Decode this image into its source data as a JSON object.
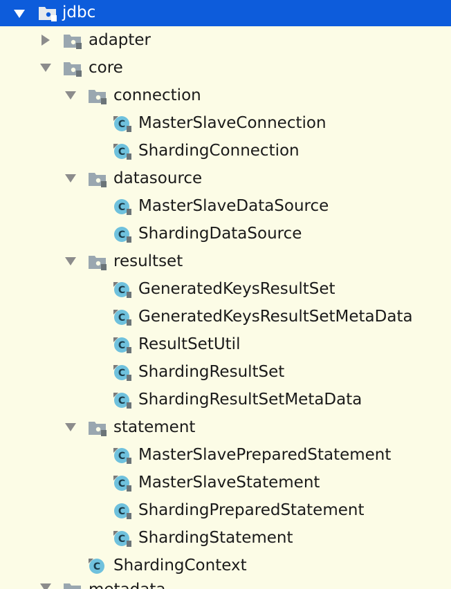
{
  "tree": {
    "root": {
      "label": "jdbc",
      "expanded": true,
      "selected": true
    },
    "rows": [
      {
        "level": 1,
        "kind": "package",
        "expanded": false,
        "label": "adapter"
      },
      {
        "level": 1,
        "kind": "package",
        "expanded": true,
        "label": "core"
      },
      {
        "level": 2,
        "kind": "package",
        "expanded": true,
        "label": "connection"
      },
      {
        "level": 3,
        "kind": "class",
        "label": "MasterSlaveConnection"
      },
      {
        "level": 3,
        "kind": "class",
        "label": "ShardingConnection"
      },
      {
        "level": 2,
        "kind": "package",
        "expanded": true,
        "label": "datasource"
      },
      {
        "level": 3,
        "kind": "class",
        "label": "MasterSlaveDataSource"
      },
      {
        "level": 3,
        "kind": "class",
        "label": "ShardingDataSource"
      },
      {
        "level": 2,
        "kind": "package",
        "expanded": true,
        "label": "resultset"
      },
      {
        "level": 3,
        "kind": "class",
        "label": "GeneratedKeysResultSet"
      },
      {
        "level": 3,
        "kind": "class",
        "label": "GeneratedKeysResultSetMetaData"
      },
      {
        "level": 3,
        "kind": "class",
        "label": "ResultSetUtil"
      },
      {
        "level": 3,
        "kind": "class",
        "label": "ShardingResultSet"
      },
      {
        "level": 3,
        "kind": "class",
        "label": "ShardingResultSetMetaData"
      },
      {
        "level": 2,
        "kind": "package",
        "expanded": true,
        "label": "statement"
      },
      {
        "level": 3,
        "kind": "class",
        "label": "MasterSlavePreparedStatement"
      },
      {
        "level": 3,
        "kind": "class",
        "label": "MasterSlaveStatement"
      },
      {
        "level": 3,
        "kind": "class",
        "label": "ShardingPreparedStatement"
      },
      {
        "level": 3,
        "kind": "class",
        "label": "ShardingStatement"
      },
      {
        "level": 2,
        "kind": "class",
        "label": "ShardingContext"
      }
    ],
    "partial_row": {
      "level": 1,
      "kind": "package",
      "expanded": true,
      "label": "metadata"
    }
  },
  "icons": {
    "package": "package-folder-icon",
    "class": "java-class-icon",
    "expanded": "triangle-down-icon",
    "collapsed": "triangle-right-icon"
  },
  "colors": {
    "background": "#fcfce6",
    "selection": "#0d5cdb",
    "class_icon": "#6fc1dd",
    "package_icon": "#9aa7b0"
  }
}
